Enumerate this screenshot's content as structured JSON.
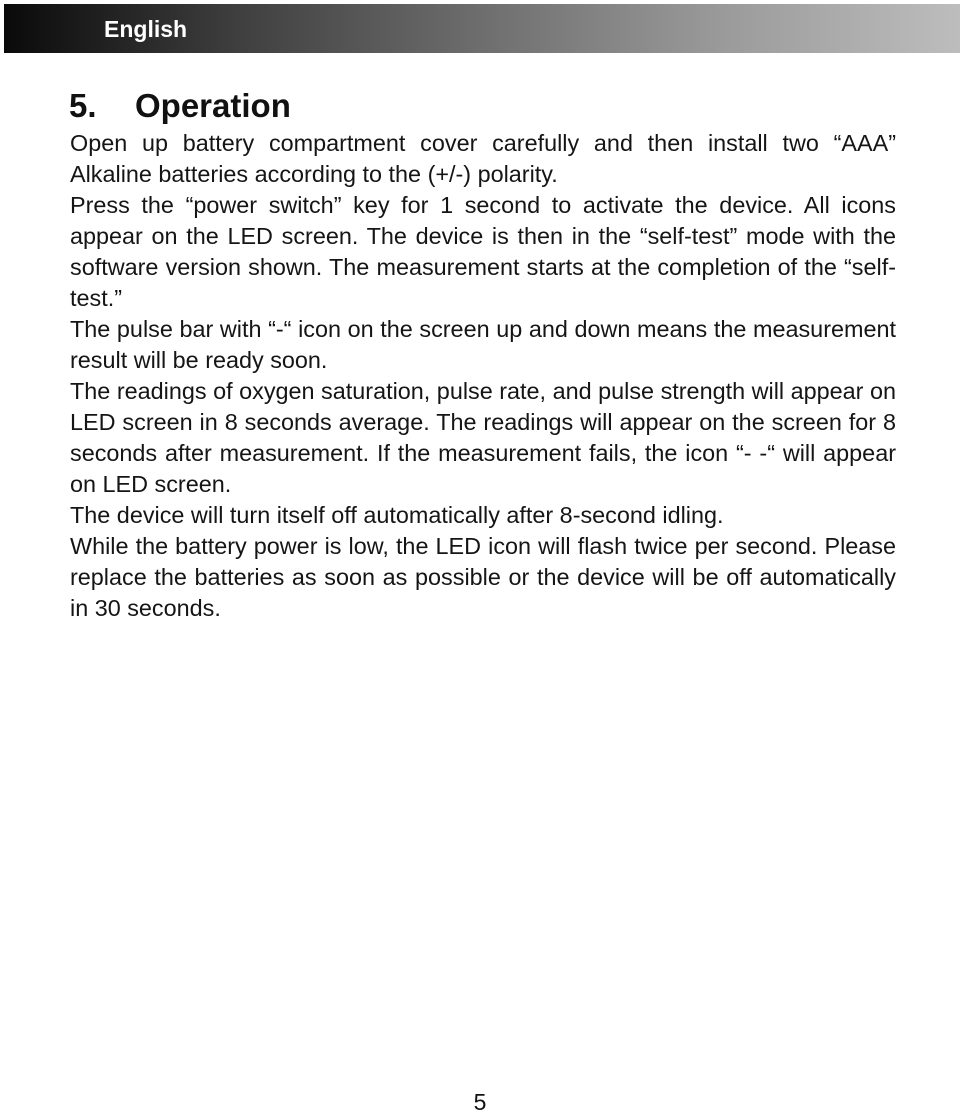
{
  "header": {
    "language_label": "English"
  },
  "section": {
    "number": "5.",
    "title": "Operation"
  },
  "paragraphs": [
    "Open up battery compartment cover carefully and then install two “AAA” Alkaline batteries according to the (+/-) polarity.",
    "Press the “power switch” key for 1 second to activate the device. All icons appear on the LED screen. The device is then in the “self-test” mode with the software version shown. The measurement starts at the completion of the “self-test.”",
    "The pulse bar with “-“ icon on the screen up and down means the measurement result will be ready soon.",
    "The readings of oxygen saturation, pulse rate, and pulse strength will appear on LED screen in 8 seconds average. The readings will appear on the screen for 8 seconds after measurement. If the measurement fails, the icon “- -“ will appear on LED screen.",
    "The device will turn itself off automatically after 8-second idling.",
    "While the battery power is low, the LED icon will flash twice per second. Please replace the batteries as soon as possible or the device will be off automatically in 30 seconds."
  ],
  "footer": {
    "page_number": "5"
  }
}
